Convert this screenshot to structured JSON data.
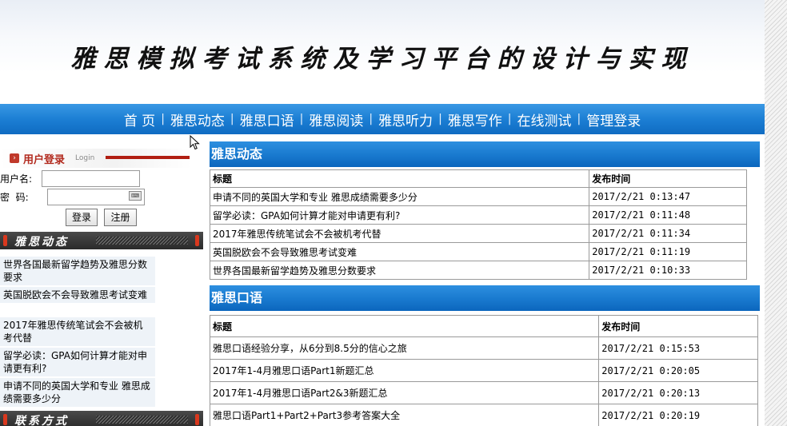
{
  "header": {
    "title": "雅思模拟考试系统及学习平台的设计与实现"
  },
  "nav": {
    "items": [
      "首 页",
      "雅思动态",
      "雅思口语",
      "雅思阅读",
      "雅思听力",
      "雅思写作",
      "在线测试",
      "管理登录"
    ],
    "separator": "|"
  },
  "login": {
    "title": "用户登录",
    "title_en": "Login",
    "username_label": "用户名:",
    "password_label": "密  码:",
    "username_value": "",
    "password_value": "",
    "login_button": "登录",
    "register_button": "注册"
  },
  "sidebar": {
    "news_title": "雅思动态",
    "news": [
      "世界各国最新留学趋势及雅思分数要求",
      "英国脱欧会不会导致雅思考试变难",
      "2017年雅思传统笔试会不会被机考代替",
      "留学必读：GPA如何计算才能对申请更有利?",
      "申请不同的英国大学和专业 雅思成绩需要多少分"
    ],
    "contact_title": "联系方式"
  },
  "dynamics": {
    "title": "雅思动态",
    "col_title": "标题",
    "col_time": "发布时间",
    "rows": [
      {
        "title": "申请不同的英国大学和专业 雅思成绩需要多少分",
        "time": "2017/2/21 0:13:47"
      },
      {
        "title": "留学必读：GPA如何计算才能对申请更有利?",
        "time": "2017/2/21 0:11:48"
      },
      {
        "title": "2017年雅思传统笔试会不会被机考代替",
        "time": "2017/2/21 0:11:34"
      },
      {
        "title": "英国脱欧会不会导致雅思考试变难",
        "time": "2017/2/21 0:11:19"
      },
      {
        "title": "世界各国最新留学趋势及雅思分数要求",
        "time": "2017/2/21 0:10:33"
      }
    ]
  },
  "speaking": {
    "title": "雅思口语",
    "col_title": "标题",
    "col_time": "发布时间",
    "rows": [
      {
        "title": "雅思口语经验分享，从6分到8.5分的信心之旅",
        "time": "2017/2/21 0:15:53"
      },
      {
        "title": "2017年1-4月雅思口语Part1新题汇总",
        "time": "2017/2/21 0:20:05"
      },
      {
        "title": "2017年1-4月雅思口语Part2&3新题汇总",
        "time": "2017/2/21 0:20:13"
      },
      {
        "title": "雅思口语Part1+Part2+Part3参考答案大全",
        "time": "2017/2/21 0:20:19"
      }
    ]
  }
}
